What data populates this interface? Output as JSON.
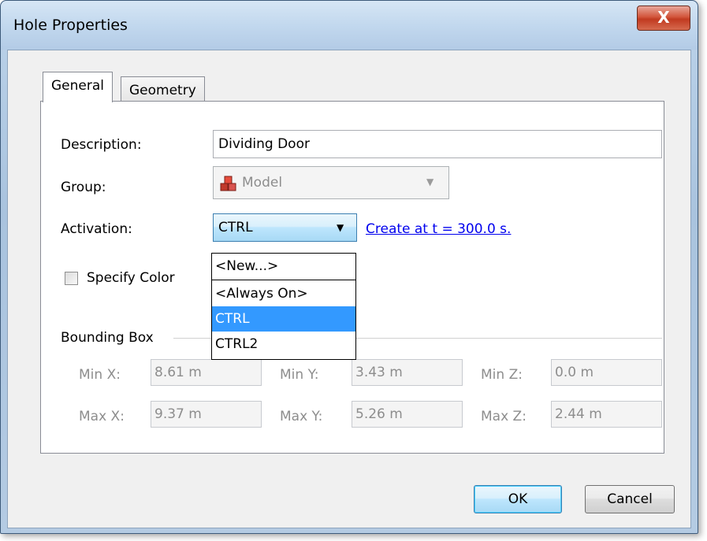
{
  "window": {
    "title": "Hole Properties",
    "close_glyph": "X"
  },
  "tabs": [
    {
      "label": "General",
      "active": true
    },
    {
      "label": "Geometry",
      "active": false
    }
  ],
  "form": {
    "description_label": "Description:",
    "description_value": "Dividing Door",
    "group_label": "Group:",
    "group_value": "Model",
    "group_icon": "model-blocks-icon",
    "activation_label": "Activation:",
    "activation_value": "CTRL",
    "activation_link": "Create at t = 300.0 s.",
    "specify_color_label": "Specify Color",
    "specify_color_checked": false
  },
  "activation_dropdown": {
    "options": [
      {
        "label": "<New...>"
      },
      {
        "label": "<Always On>"
      },
      {
        "label": "CTRL",
        "selected": true
      },
      {
        "label": "CTRL2"
      }
    ]
  },
  "bounding_box": {
    "title": "Bounding Box",
    "min_x_label": "Min X:",
    "min_x": "8.61 m",
    "min_y_label": "Min Y:",
    "min_y": "3.43 m",
    "min_z_label": "Min Z:",
    "min_z": "0.0 m",
    "max_x_label": "Max X:",
    "max_x": "9.37 m",
    "max_y_label": "Max Y:",
    "max_y": "5.26 m",
    "max_z_label": "Max Z:",
    "max_z": "2.44 m"
  },
  "buttons": {
    "ok": "OK",
    "cancel": "Cancel"
  },
  "colors": {
    "selection": "#3399ff",
    "link": "#0000ee",
    "disabled_text": "#8d8d8d"
  }
}
